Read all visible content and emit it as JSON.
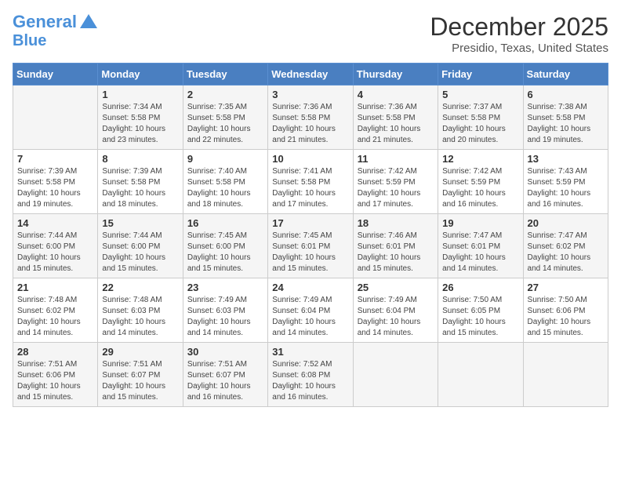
{
  "header": {
    "logo_line1": "General",
    "logo_line2": "Blue",
    "title": "December 2025",
    "subtitle": "Presidio, Texas, United States"
  },
  "days_of_week": [
    "Sunday",
    "Monday",
    "Tuesday",
    "Wednesday",
    "Thursday",
    "Friday",
    "Saturday"
  ],
  "weeks": [
    [
      {
        "day": "",
        "info": ""
      },
      {
        "day": "1",
        "info": "Sunrise: 7:34 AM\nSunset: 5:58 PM\nDaylight: 10 hours and 23 minutes."
      },
      {
        "day": "2",
        "info": "Sunrise: 7:35 AM\nSunset: 5:58 PM\nDaylight: 10 hours and 22 minutes."
      },
      {
        "day": "3",
        "info": "Sunrise: 7:36 AM\nSunset: 5:58 PM\nDaylight: 10 hours and 21 minutes."
      },
      {
        "day": "4",
        "info": "Sunrise: 7:36 AM\nSunset: 5:58 PM\nDaylight: 10 hours and 21 minutes."
      },
      {
        "day": "5",
        "info": "Sunrise: 7:37 AM\nSunset: 5:58 PM\nDaylight: 10 hours and 20 minutes."
      },
      {
        "day": "6",
        "info": "Sunrise: 7:38 AM\nSunset: 5:58 PM\nDaylight: 10 hours and 19 minutes."
      }
    ],
    [
      {
        "day": "7",
        "info": "Sunrise: 7:39 AM\nSunset: 5:58 PM\nDaylight: 10 hours and 19 minutes."
      },
      {
        "day": "8",
        "info": "Sunrise: 7:39 AM\nSunset: 5:58 PM\nDaylight: 10 hours and 18 minutes."
      },
      {
        "day": "9",
        "info": "Sunrise: 7:40 AM\nSunset: 5:58 PM\nDaylight: 10 hours and 18 minutes."
      },
      {
        "day": "10",
        "info": "Sunrise: 7:41 AM\nSunset: 5:58 PM\nDaylight: 10 hours and 17 minutes."
      },
      {
        "day": "11",
        "info": "Sunrise: 7:42 AM\nSunset: 5:59 PM\nDaylight: 10 hours and 17 minutes."
      },
      {
        "day": "12",
        "info": "Sunrise: 7:42 AM\nSunset: 5:59 PM\nDaylight: 10 hours and 16 minutes."
      },
      {
        "day": "13",
        "info": "Sunrise: 7:43 AM\nSunset: 5:59 PM\nDaylight: 10 hours and 16 minutes."
      }
    ],
    [
      {
        "day": "14",
        "info": "Sunrise: 7:44 AM\nSunset: 6:00 PM\nDaylight: 10 hours and 15 minutes."
      },
      {
        "day": "15",
        "info": "Sunrise: 7:44 AM\nSunset: 6:00 PM\nDaylight: 10 hours and 15 minutes."
      },
      {
        "day": "16",
        "info": "Sunrise: 7:45 AM\nSunset: 6:00 PM\nDaylight: 10 hours and 15 minutes."
      },
      {
        "day": "17",
        "info": "Sunrise: 7:45 AM\nSunset: 6:01 PM\nDaylight: 10 hours and 15 minutes."
      },
      {
        "day": "18",
        "info": "Sunrise: 7:46 AM\nSunset: 6:01 PM\nDaylight: 10 hours and 15 minutes."
      },
      {
        "day": "19",
        "info": "Sunrise: 7:47 AM\nSunset: 6:01 PM\nDaylight: 10 hours and 14 minutes."
      },
      {
        "day": "20",
        "info": "Sunrise: 7:47 AM\nSunset: 6:02 PM\nDaylight: 10 hours and 14 minutes."
      }
    ],
    [
      {
        "day": "21",
        "info": "Sunrise: 7:48 AM\nSunset: 6:02 PM\nDaylight: 10 hours and 14 minutes."
      },
      {
        "day": "22",
        "info": "Sunrise: 7:48 AM\nSunset: 6:03 PM\nDaylight: 10 hours and 14 minutes."
      },
      {
        "day": "23",
        "info": "Sunrise: 7:49 AM\nSunset: 6:03 PM\nDaylight: 10 hours and 14 minutes."
      },
      {
        "day": "24",
        "info": "Sunrise: 7:49 AM\nSunset: 6:04 PM\nDaylight: 10 hours and 14 minutes."
      },
      {
        "day": "25",
        "info": "Sunrise: 7:49 AM\nSunset: 6:04 PM\nDaylight: 10 hours and 14 minutes."
      },
      {
        "day": "26",
        "info": "Sunrise: 7:50 AM\nSunset: 6:05 PM\nDaylight: 10 hours and 15 minutes."
      },
      {
        "day": "27",
        "info": "Sunrise: 7:50 AM\nSunset: 6:06 PM\nDaylight: 10 hours and 15 minutes."
      }
    ],
    [
      {
        "day": "28",
        "info": "Sunrise: 7:51 AM\nSunset: 6:06 PM\nDaylight: 10 hours and 15 minutes."
      },
      {
        "day": "29",
        "info": "Sunrise: 7:51 AM\nSunset: 6:07 PM\nDaylight: 10 hours and 15 minutes."
      },
      {
        "day": "30",
        "info": "Sunrise: 7:51 AM\nSunset: 6:07 PM\nDaylight: 10 hours and 16 minutes."
      },
      {
        "day": "31",
        "info": "Sunrise: 7:52 AM\nSunset: 6:08 PM\nDaylight: 10 hours and 16 minutes."
      },
      {
        "day": "",
        "info": ""
      },
      {
        "day": "",
        "info": ""
      },
      {
        "day": "",
        "info": ""
      }
    ]
  ]
}
